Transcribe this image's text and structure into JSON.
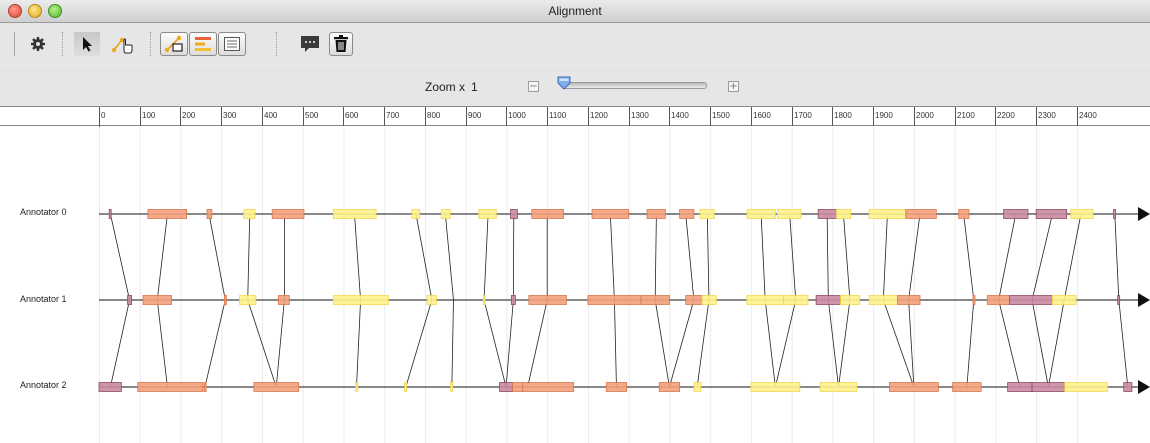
{
  "window": {
    "title": "Alignment"
  },
  "toolbar": {
    "buttons": [
      {
        "name": "settings-button",
        "icon": "gear-icon"
      },
      {
        "name": "select-tool-button",
        "icon": "arrow-pointer-icon",
        "pressed": true
      },
      {
        "name": "draw-link-tool-button",
        "icon": "hand-link-icon"
      },
      {
        "name": "relation-view-button",
        "icon": "relation-view-icon"
      },
      {
        "name": "timeline-view-button",
        "icon": "timeline-bars-icon"
      },
      {
        "name": "list-view-button",
        "icon": "list-icon"
      },
      {
        "name": "comment-button",
        "icon": "speech-bubble-icon"
      },
      {
        "name": "delete-button",
        "icon": "trash-icon"
      }
    ]
  },
  "zoom": {
    "label": "Zoom x",
    "value": "1",
    "minus_icon": "zoom-out-icon",
    "plus_icon": "zoom-in-icon",
    "level": 0.0
  },
  "ruler": {
    "ticks": [
      "0",
      "100",
      "200",
      "300",
      "400",
      "500",
      "600",
      "700",
      "800",
      "900",
      "1000",
      "1100",
      "1200",
      "1300",
      "1400",
      "1500",
      "1600",
      "1700",
      "1800",
      "1900",
      "2000",
      "2100",
      "2200",
      "2300",
      "2400"
    ]
  },
  "annotators": [
    "Annotator 0",
    "Annotator 1",
    "Annotator 2"
  ],
  "colors": {
    "orange": "#f3a07c",
    "orange_border": "#d9774e",
    "yellow": "#fff28c",
    "yellow_border": "#f2d650",
    "purple": "#c98aa2",
    "purple_border": "#8f4b66",
    "line": "#222222"
  },
  "timeline_data": {
    "unit": "ruler units",
    "units_max": 2550,
    "tracks": [
      {
        "annotator": "Annotator 0",
        "units": [
          {
            "s": 25,
            "e": 30,
            "c": "purple"
          },
          {
            "s": 120,
            "e": 215,
            "c": "orange"
          },
          {
            "s": 265,
            "e": 277,
            "c": "orange"
          },
          {
            "s": 355,
            "e": 383,
            "c": "yellow"
          },
          {
            "s": 425,
            "e": 503,
            "c": "orange"
          },
          {
            "s": 575,
            "e": 680,
            "c": "yellow"
          },
          {
            "s": 768,
            "e": 787,
            "c": "yellow"
          },
          {
            "s": 840,
            "e": 862,
            "c": "yellow"
          },
          {
            "s": 932,
            "e": 975,
            "c": "yellow"
          },
          {
            "s": 1010,
            "e": 1027,
            "c": "purple"
          },
          {
            "s": 1062,
            "e": 1140,
            "c": "orange"
          },
          {
            "s": 1210,
            "e": 1300,
            "c": "orange"
          },
          {
            "s": 1345,
            "e": 1390,
            "c": "orange"
          },
          {
            "s": 1425,
            "e": 1460,
            "c": "orange"
          },
          {
            "s": 1475,
            "e": 1510,
            "c": "yellow"
          },
          {
            "s": 1590,
            "e": 1660,
            "c": "yellow"
          },
          {
            "s": 1665,
            "e": 1723,
            "c": "yellow"
          },
          {
            "s": 1765,
            "e": 1810,
            "c": "purple"
          },
          {
            "s": 1810,
            "e": 1845,
            "c": "yellow"
          },
          {
            "s": 1890,
            "e": 1980,
            "c": "yellow"
          },
          {
            "s": 1980,
            "e": 2055,
            "c": "orange"
          },
          {
            "s": 2110,
            "e": 2135,
            "c": "orange"
          },
          {
            "s": 2220,
            "e": 2280,
            "c": "purple"
          },
          {
            "s": 2300,
            "e": 2375,
            "c": "purple"
          },
          {
            "s": 2385,
            "e": 2440,
            "c": "yellow"
          },
          {
            "s": 2490,
            "e": 2495,
            "c": "purple"
          }
        ]
      },
      {
        "annotator": "Annotator 1",
        "units": [
          {
            "s": 70,
            "e": 80,
            "c": "purple"
          },
          {
            "s": 108,
            "e": 178,
            "c": "orange"
          },
          {
            "s": 308,
            "e": 312,
            "c": "orange"
          },
          {
            "s": 345,
            "e": 385,
            "c": "yellow"
          },
          {
            "s": 440,
            "e": 467,
            "c": "orange"
          },
          {
            "s": 575,
            "e": 710,
            "c": "yellow"
          },
          {
            "s": 805,
            "e": 828,
            "c": "yellow"
          },
          {
            "s": 943,
            "e": 948,
            "c": "yellow"
          },
          {
            "s": 1012,
            "e": 1022,
            "c": "purple"
          },
          {
            "s": 1055,
            "e": 1147,
            "c": "orange"
          },
          {
            "s": 1200,
            "e": 1330,
            "c": "orange"
          },
          {
            "s": 1330,
            "e": 1400,
            "c": "orange"
          },
          {
            "s": 1440,
            "e": 1480,
            "c": "orange"
          },
          {
            "s": 1480,
            "e": 1515,
            "c": "yellow"
          },
          {
            "s": 1590,
            "e": 1680,
            "c": "yellow"
          },
          {
            "s": 1680,
            "e": 1740,
            "c": "yellow"
          },
          {
            "s": 1760,
            "e": 1820,
            "c": "purple"
          },
          {
            "s": 1820,
            "e": 1867,
            "c": "yellow"
          },
          {
            "s": 1890,
            "e": 1960,
            "c": "yellow"
          },
          {
            "s": 1960,
            "e": 2015,
            "c": "orange"
          },
          {
            "s": 2145,
            "e": 2150,
            "c": "orange"
          },
          {
            "s": 2180,
            "e": 2235,
            "c": "orange"
          },
          {
            "s": 2235,
            "e": 2340,
            "c": "purple"
          },
          {
            "s": 2340,
            "e": 2398,
            "c": "yellow"
          },
          {
            "s": 2500,
            "e": 2505,
            "c": "purple"
          }
        ]
      },
      {
        "annotator": "Annotator 2",
        "units": [
          {
            "s": 0,
            "e": 55,
            "c": "purple"
          },
          {
            "s": 95,
            "e": 255,
            "c": "orange"
          },
          {
            "s": 258,
            "e": 262,
            "c": "orange"
          },
          {
            "s": 380,
            "e": 490,
            "c": "orange"
          },
          {
            "s": 630,
            "e": 635,
            "c": "yellow"
          },
          {
            "s": 750,
            "e": 755,
            "c": "yellow"
          },
          {
            "s": 863,
            "e": 868,
            "c": "yellow"
          },
          {
            "s": 983,
            "e": 1015,
            "c": "purple"
          },
          {
            "s": 1015,
            "e": 1040,
            "c": "orange"
          },
          {
            "s": 1040,
            "e": 1165,
            "c": "orange"
          },
          {
            "s": 1245,
            "e": 1295,
            "c": "orange"
          },
          {
            "s": 1375,
            "e": 1425,
            "c": "orange"
          },
          {
            "s": 1460,
            "e": 1477,
            "c": "yellow"
          },
          {
            "s": 1600,
            "e": 1720,
            "c": "yellow"
          },
          {
            "s": 1770,
            "e": 1860,
            "c": "yellow"
          },
          {
            "s": 1940,
            "e": 2060,
            "c": "orange"
          },
          {
            "s": 2095,
            "e": 2165,
            "c": "orange"
          },
          {
            "s": 2230,
            "e": 2290,
            "c": "purple"
          },
          {
            "s": 2290,
            "e": 2370,
            "c": "purple"
          },
          {
            "s": 2370,
            "e": 2475,
            "c": "yellow"
          },
          {
            "s": 2515,
            "e": 2535,
            "c": "purple"
          }
        ]
      }
    ],
    "links": [
      [
        28,
        75
      ],
      [
        168,
        143
      ],
      [
        270,
        310
      ],
      [
        370,
        365
      ],
      [
        455,
        455
      ],
      [
        627,
        642
      ],
      [
        778,
        817
      ],
      [
        850,
        870
      ],
      [
        955,
        945
      ],
      [
        1018,
        1017
      ],
      [
        1100,
        1100
      ],
      [
        1255,
        1265
      ],
      [
        1368,
        1365
      ],
      [
        1440,
        1460
      ],
      [
        1493,
        1497
      ],
      [
        1625,
        1635
      ],
      [
        1695,
        1710
      ],
      [
        1787,
        1790
      ],
      [
        1827,
        1843
      ],
      [
        1935,
        1925
      ],
      [
        2015,
        1987
      ],
      [
        2122,
        2147
      ],
      [
        2250,
        2208
      ],
      [
        2340,
        2290
      ],
      [
        2410,
        2369
      ],
      [
        2493,
        2503
      ]
    ],
    "links12": [
      [
        75,
        28
      ],
      [
        143,
        168
      ],
      [
        310,
        260
      ],
      [
        365,
        435
      ],
      [
        455,
        435
      ],
      [
        642,
        632
      ],
      [
        817,
        753
      ],
      [
        870,
        866
      ],
      [
        945,
        999
      ],
      [
        1017,
        999
      ],
      [
        1100,
        1052
      ],
      [
        1265,
        1270
      ],
      [
        1365,
        1400
      ],
      [
        1460,
        1400
      ],
      [
        1497,
        1468
      ],
      [
        1635,
        1660
      ],
      [
        1710,
        1660
      ],
      [
        1790,
        1815
      ],
      [
        1843,
        1815
      ],
      [
        1925,
        2000
      ],
      [
        1987,
        2000
      ],
      [
        2147,
        2130
      ],
      [
        2208,
        2260
      ],
      [
        2290,
        2330
      ],
      [
        2369,
        2330
      ],
      [
        2503,
        2525
      ]
    ]
  }
}
